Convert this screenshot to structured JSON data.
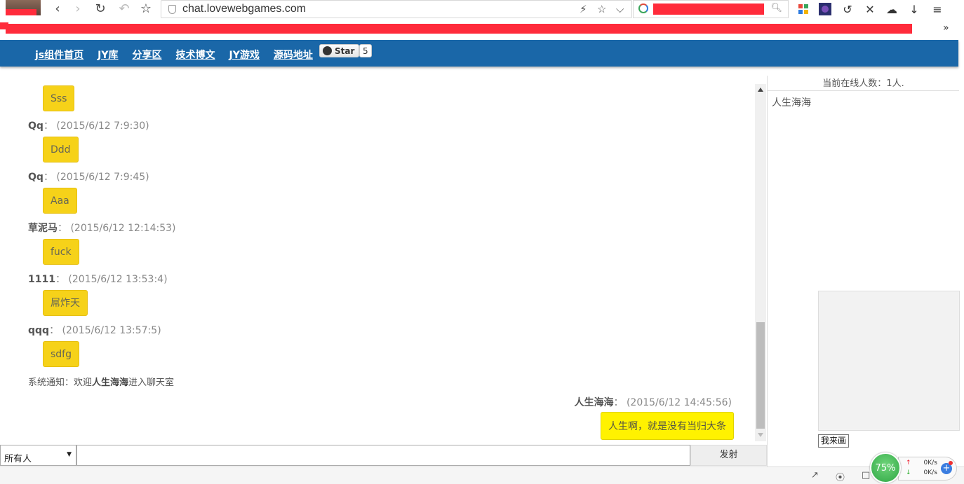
{
  "browser": {
    "url": "chat.lovewebgames.com",
    "nav_icons": [
      "back-icon",
      "forward-icon",
      "reload-icon",
      "undo-icon",
      "bookmark-star-icon"
    ],
    "more_bookmarks": "»"
  },
  "site_nav": {
    "links": [
      "js组件首页",
      "JY库",
      "分享区",
      "技术博文",
      "JY游戏",
      "源码地址"
    ],
    "star_label": "Star",
    "star_count": "5"
  },
  "chat": {
    "messages": [
      {
        "text": "Sss"
      },
      {
        "nick": "Qq",
        "sep": "：",
        "time": "(2015/6/12 7:9:30)",
        "text": "Ddd"
      },
      {
        "nick": "Qq",
        "sep": "：",
        "time": "(2015/6/12 7:9:45)",
        "text": "Aaa"
      },
      {
        "nick": "草泥马",
        "sep": "：",
        "time": "(2015/6/12 12:14:53)",
        "text": "fuck"
      },
      {
        "nick": "1111",
        "sep": "：",
        "time": "(2015/6/12 13:53:4)",
        "text": "屌炸天"
      },
      {
        "nick": "qqq",
        "sep": "：",
        "time": "(2015/6/12 13:57:5)",
        "text": "sdfg"
      }
    ],
    "system": {
      "prefix": "系统通知：欢迎",
      "user": "人生海海",
      "suffix": "进入聊天室"
    },
    "own": {
      "nick": "人生海海",
      "sep": "：",
      "time": "(2015/6/12 14:45:56)",
      "text": "人生啊，就是没有当归大条"
    }
  },
  "right_panel": {
    "online_count": "当前在线人数：1人.",
    "users": [
      "人生海海"
    ],
    "draw_button": "我来画"
  },
  "input_bar": {
    "recipient": "所有人",
    "message_value": "",
    "send_label": "发射"
  },
  "status": {
    "percent": "75%",
    "upload": "0K/s",
    "download": "0K/s"
  }
}
